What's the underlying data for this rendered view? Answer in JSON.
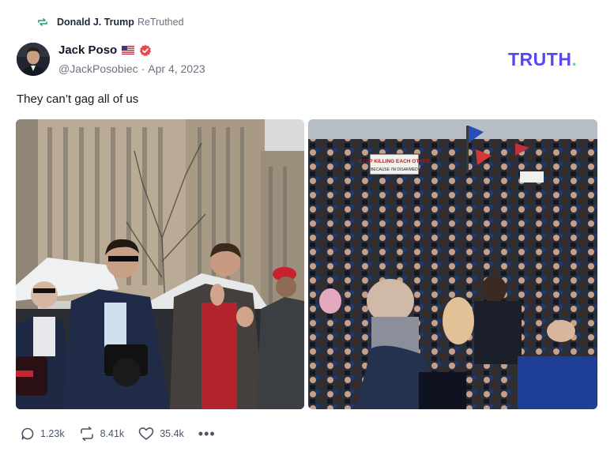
{
  "retruth": {
    "user": "Donald J. Trump",
    "label": "ReTruthed",
    "icon": "retruth-icon"
  },
  "post": {
    "author_name": "Jack Poso",
    "handle": "@JackPosobiec",
    "separator": "·",
    "date": "Apr 4, 2023",
    "text": "They can’t gag all of us",
    "flag_icon": "us-flag-icon",
    "verified_icon": "verified-badge-icon"
  },
  "brand": {
    "logo_text": "TRUTH",
    "logo_dot": ".",
    "color": "#5448ee",
    "dot_color": "#5fd4b8"
  },
  "media": {
    "left": {
      "sign_text": ""
    },
    "right": {
      "sign_text": "STOP KILLING EACH OTHER",
      "sign_subtext": "BECAUSE I'M DISARMED"
    }
  },
  "actions": {
    "replies": "1.23k",
    "retruths": "8.41k",
    "likes": "35.4k",
    "more": "•••"
  }
}
